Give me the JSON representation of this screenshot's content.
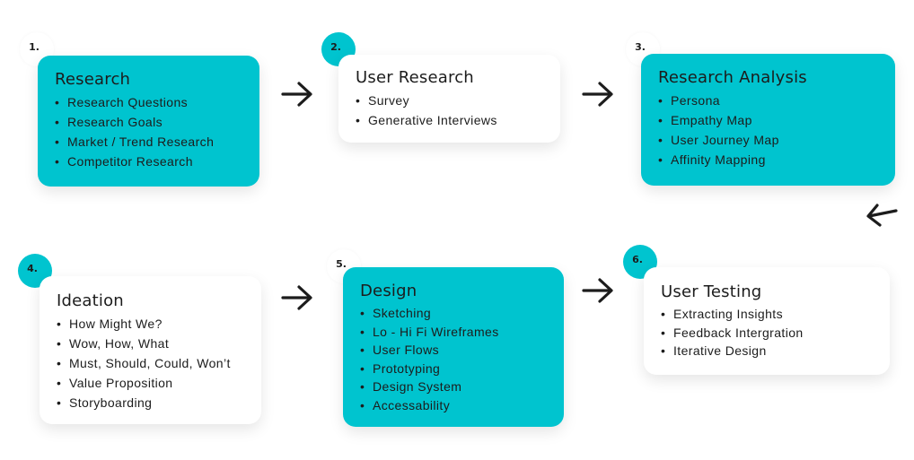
{
  "accent_color": "#00c4cf",
  "steps": [
    {
      "number": "1.",
      "title": "Research",
      "style": "teal",
      "items": [
        "Research Questions",
        "Research Goals",
        "Market / Trend Research",
        "Competitor Research"
      ]
    },
    {
      "number": "2.",
      "title": "User Research",
      "style": "white",
      "items": [
        "Survey",
        "Generative Interviews"
      ]
    },
    {
      "number": "3.",
      "title": "Research Analysis",
      "style": "teal",
      "items": [
        "Persona",
        "Empathy Map",
        "User Journey Map",
        "Affinity Mapping"
      ]
    },
    {
      "number": "4.",
      "title": "Ideation",
      "style": "white",
      "items": [
        "How Might We?",
        "Wow, How, What",
        "Must, Should, Could, Won’t",
        "Value Proposition",
        "Storyboarding"
      ]
    },
    {
      "number": "5.",
      "title": "Design",
      "style": "teal",
      "items": [
        "Sketching",
        "Lo - Hi Fi Wireframes",
        "User Flows",
        "Prototyping",
        "Design System",
        "Accessability"
      ]
    },
    {
      "number": "6.",
      "title": "User Testing",
      "style": "white",
      "items": [
        "Extracting Insights",
        "Feedback Intergration",
        "Iterative Design"
      ]
    }
  ],
  "arrows": [
    {
      "from": "1",
      "to": "2",
      "icon": "arrow-right-icon"
    },
    {
      "from": "2",
      "to": "3",
      "icon": "arrow-right-icon"
    },
    {
      "from": "3",
      "to": "4",
      "icon": "arrow-left-icon"
    },
    {
      "from": "4",
      "to": "5",
      "icon": "arrow-right-icon"
    },
    {
      "from": "5",
      "to": "6",
      "icon": "arrow-right-icon"
    }
  ]
}
